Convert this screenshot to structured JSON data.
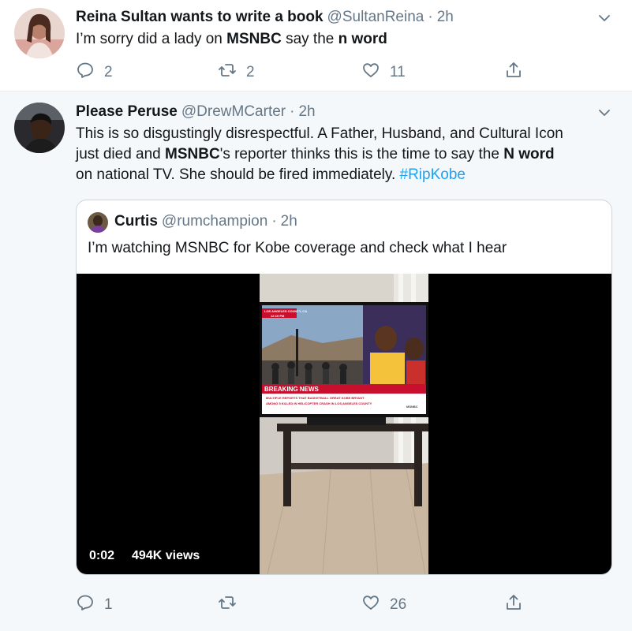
{
  "tweets": [
    {
      "author_name": "Reina Sultan wants to write a book",
      "handle": "@SultanReina",
      "dot": "·",
      "time": "2h",
      "text": {
        "p1": "I’m sorry did a lady on ",
        "b1": "MSNBC",
        "p2": " say the ",
        "b2": "n word"
      },
      "stats": {
        "replies": "2",
        "retweets": "2",
        "likes": "11"
      }
    },
    {
      "author_name": "Please Peruse",
      "handle": "@DrewMCarter",
      "dot": "·",
      "time": "2h",
      "text": {
        "line1": "This is so disgustingly disrespectful. A Father, Husband, and Cultural Icon",
        "l2a": "just died and ",
        "l2b": "MSNBC",
        "l2c": "'s reporter thinks this is the time to say the ",
        "l2d": "N word",
        "l3a": "on national TV. She should be fired immediately. ",
        "hashtag": "#RipKobe"
      },
      "quoted": {
        "author_name": "Curtis",
        "handle": "@rumchampion",
        "dot": "·",
        "time": "2h",
        "text": "I’m watching MSNBC for Kobe coverage and check what I hear",
        "video": {
          "duration": "0:02",
          "views": "494K views",
          "screen_text": {
            "location": "LOS ANGELES COUNTY, CA",
            "clock": "12:19 PM",
            "banner": "BREAKING NEWS",
            "ticker1": "MULTIPLE REPORTS THAT BASKETBALL GREAT KOBE BRYANT",
            "ticker2": "AMONG 5 KILLED IN HELICOPTER CRASH IN LOS ANGELES COUNTY",
            "network": "MSNBC"
          }
        }
      },
      "stats": {
        "replies": "1",
        "retweets": "",
        "likes": "26"
      }
    }
  ],
  "icons": {
    "reply": "reply-icon",
    "retweet": "retweet-icon",
    "like": "like-icon",
    "share": "share-icon",
    "caret": "chevron-down-icon"
  },
  "colors": {
    "link": "#1da1f2",
    "muted": "#657786",
    "text": "#14171a",
    "bg_alt": "#f5f8fa"
  }
}
